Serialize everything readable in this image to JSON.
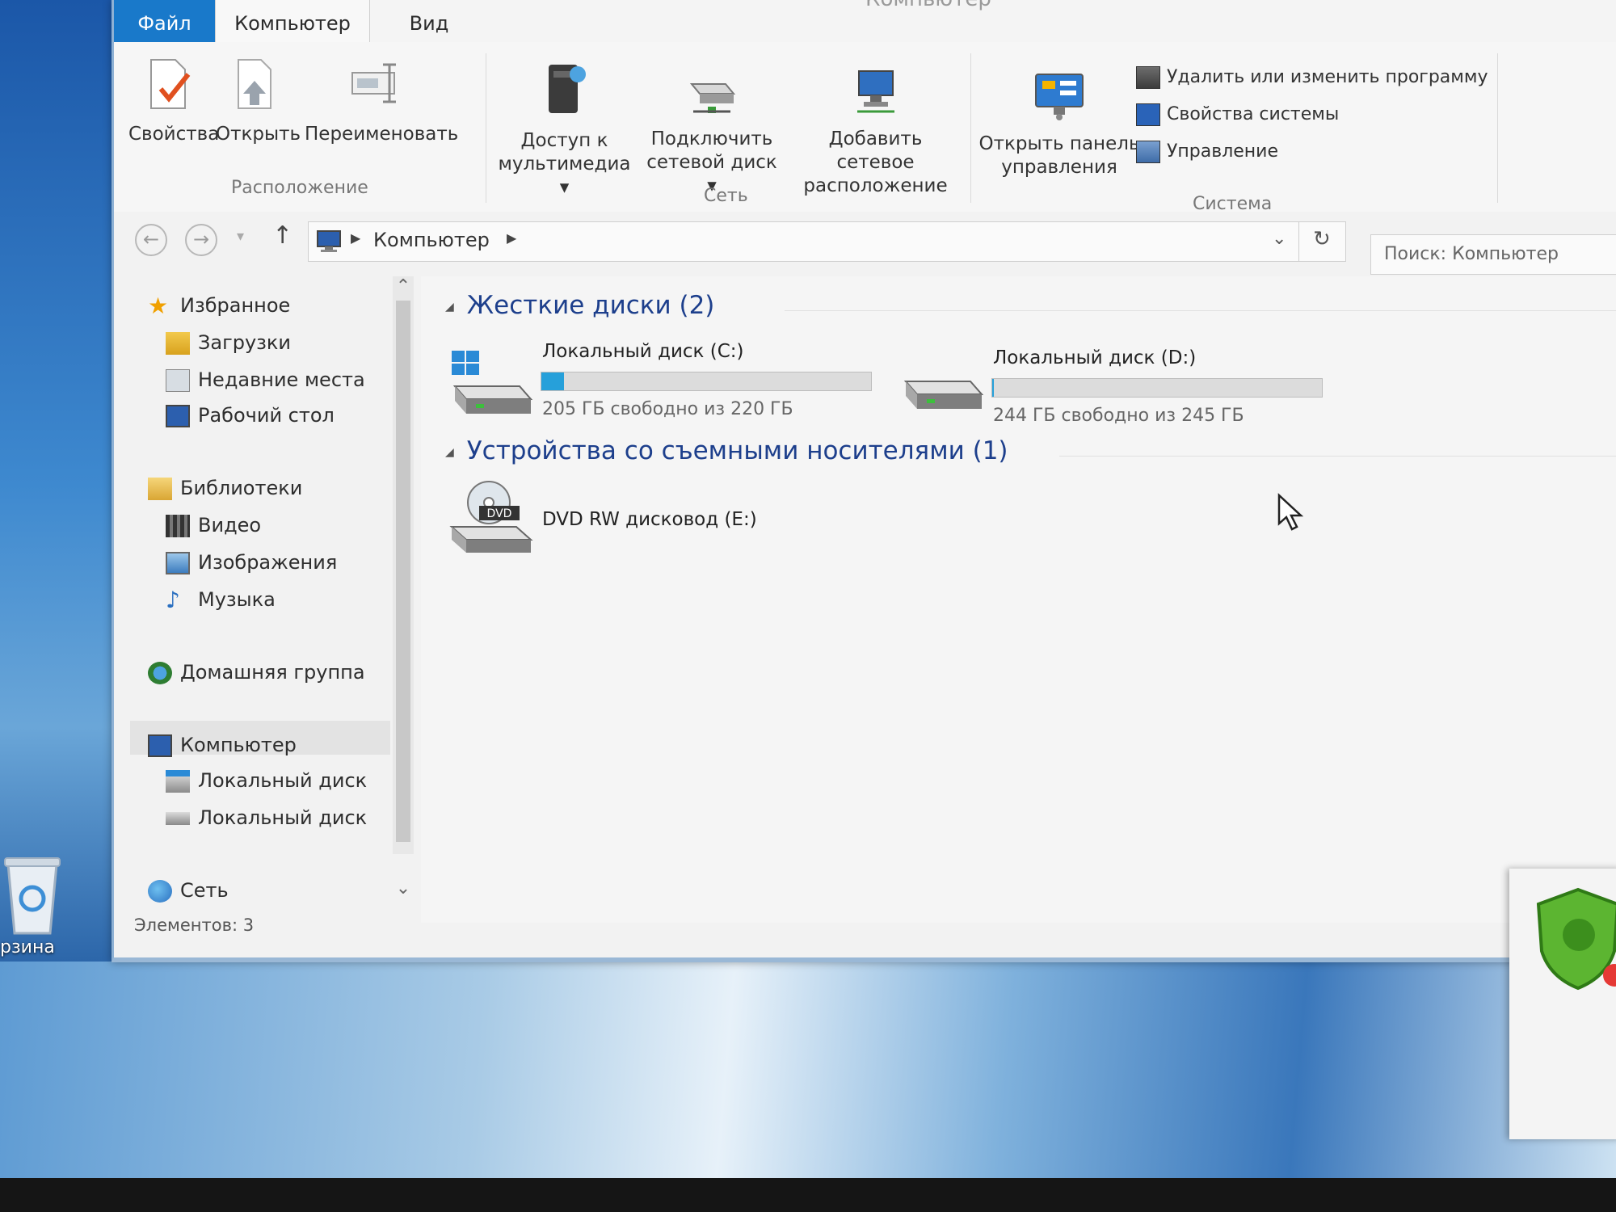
{
  "window": {
    "title": "Компьютер"
  },
  "tabs": [
    {
      "label": "Файл"
    },
    {
      "label": "Компьютер"
    },
    {
      "label": "Вид"
    }
  ],
  "ribbon": {
    "location_group": {
      "label": "Расположение",
      "buttons": [
        "Свойства",
        "Открыть",
        "Переименовать"
      ]
    },
    "network_group": {
      "label": "Сеть",
      "buttons": [
        {
          "line1": "Доступ к",
          "line2": "мультимедиа"
        },
        {
          "line1": "Подключить",
          "line2": "сетевой диск"
        },
        {
          "line1": "Добавить сетевое",
          "line2": "расположение"
        }
      ]
    },
    "system_group": {
      "label": "Система",
      "control_panel": {
        "line1": "Открыть панель",
        "line2": "управления"
      },
      "small_buttons": [
        "Удалить или изменить программу",
        "Свойства системы",
        "Управление"
      ]
    }
  },
  "address": {
    "crumb": "Компьютер",
    "search_placeholder": "Поиск: Компьютер"
  },
  "nav": {
    "favorites": "Избранное",
    "downloads": "Загрузки",
    "recent": "Недавние места",
    "desktop": "Рабочий стол",
    "libraries": "Библиотеки",
    "videos": "Видео",
    "images": "Изображения",
    "music": "Музыка",
    "homegroup": "Домашняя группа",
    "computer": "Компьютер",
    "local_c": "Локальный диск",
    "local_d": "Локальный диск",
    "network": "Сеть"
  },
  "content": {
    "hard_drives_header": "Жесткие диски (2)",
    "removable_header": "Устройства со съемными носителями (1)",
    "drives": [
      {
        "name": "Локальный диск (C:)",
        "free_text": "205 ГБ свободно из 220 ГБ",
        "used_fraction": 0.068
      },
      {
        "name": "Локальный диск (D:)",
        "free_text": "244 ГБ свободно из 245 ГБ",
        "used_fraction": 0.004
      }
    ],
    "dvd": {
      "name": "DVD RW дисковод (E:)",
      "badge": "DVD"
    }
  },
  "status": {
    "items": "Элементов: 3"
  },
  "desktop": {
    "recycle_label": "рзина"
  },
  "colors": {
    "accent": "#1979ca",
    "bar_fill": "#26a0da",
    "header_text": "#1d3f8c"
  }
}
